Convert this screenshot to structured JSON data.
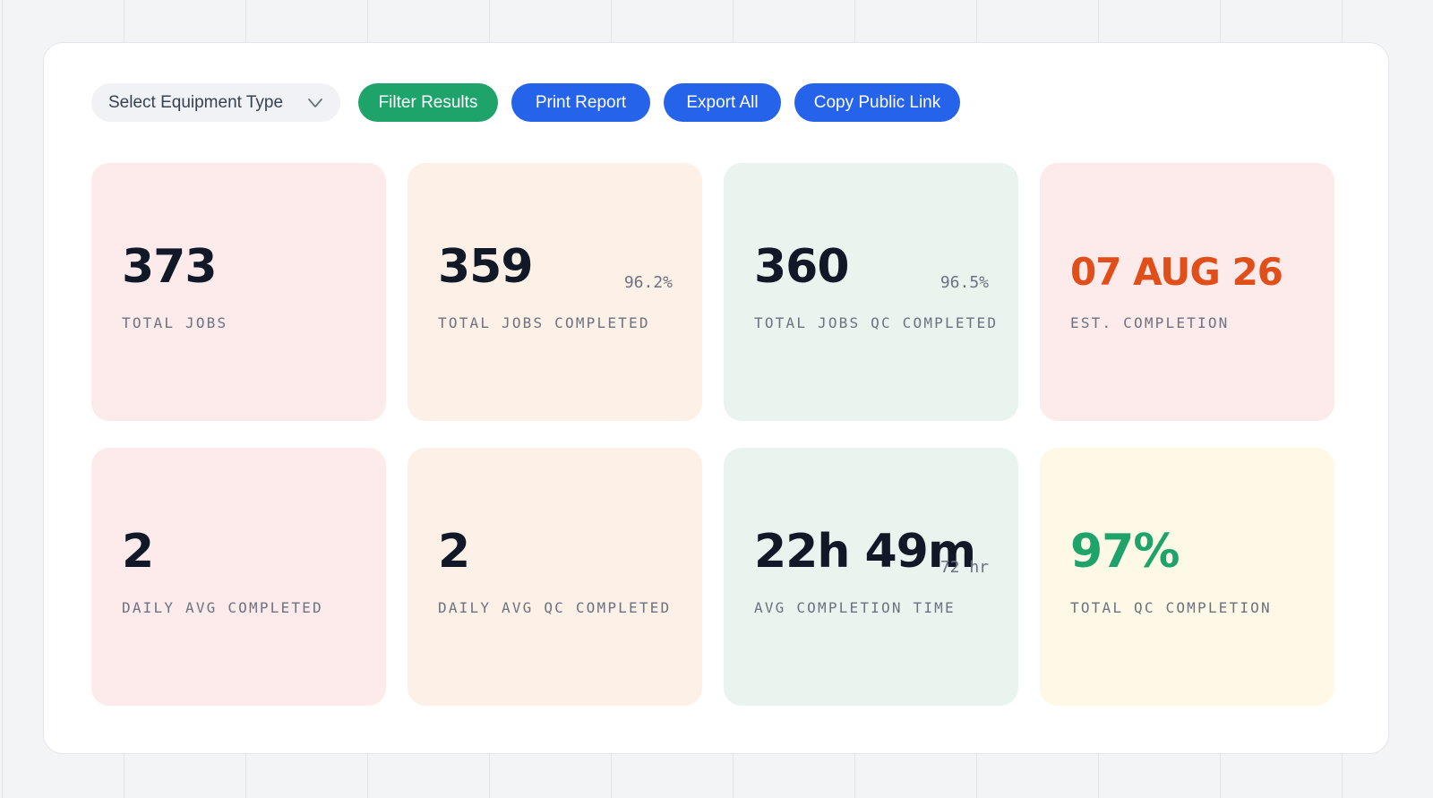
{
  "toolbar": {
    "select_label": "Select Equipment Type",
    "filter_label": "Filter Results",
    "print_label": "Print Report",
    "export_label": "Export All",
    "copy_label": "Copy Public Link"
  },
  "colors": {
    "filter_button": "#1ea36b",
    "action_button": "#2563eb",
    "date_value": "#e04f1a",
    "percent_value": "#1ea36b"
  },
  "cards": [
    {
      "value": "373",
      "label": "TOTAL JOBS",
      "sub": ""
    },
    {
      "value": "359",
      "label": "TOTAL JOBS COMPLETED",
      "sub": "96.2%"
    },
    {
      "value": "360",
      "label": "TOTAL JOBS QC COMPLETED",
      "sub": "96.5%"
    },
    {
      "value": "07 AUG 26",
      "label": "EST. COMPLETION",
      "sub": ""
    },
    {
      "value": "2",
      "label": "DAILY AVG COMPLETED",
      "sub": ""
    },
    {
      "value": "2",
      "label": "DAILY AVG QC COMPLETED",
      "sub": ""
    },
    {
      "value": "22h 49m",
      "label": "AVG COMPLETION TIME",
      "sub": "72 hr"
    },
    {
      "value": "97%",
      "label": "TOTAL QC COMPLETION",
      "sub": ""
    }
  ]
}
